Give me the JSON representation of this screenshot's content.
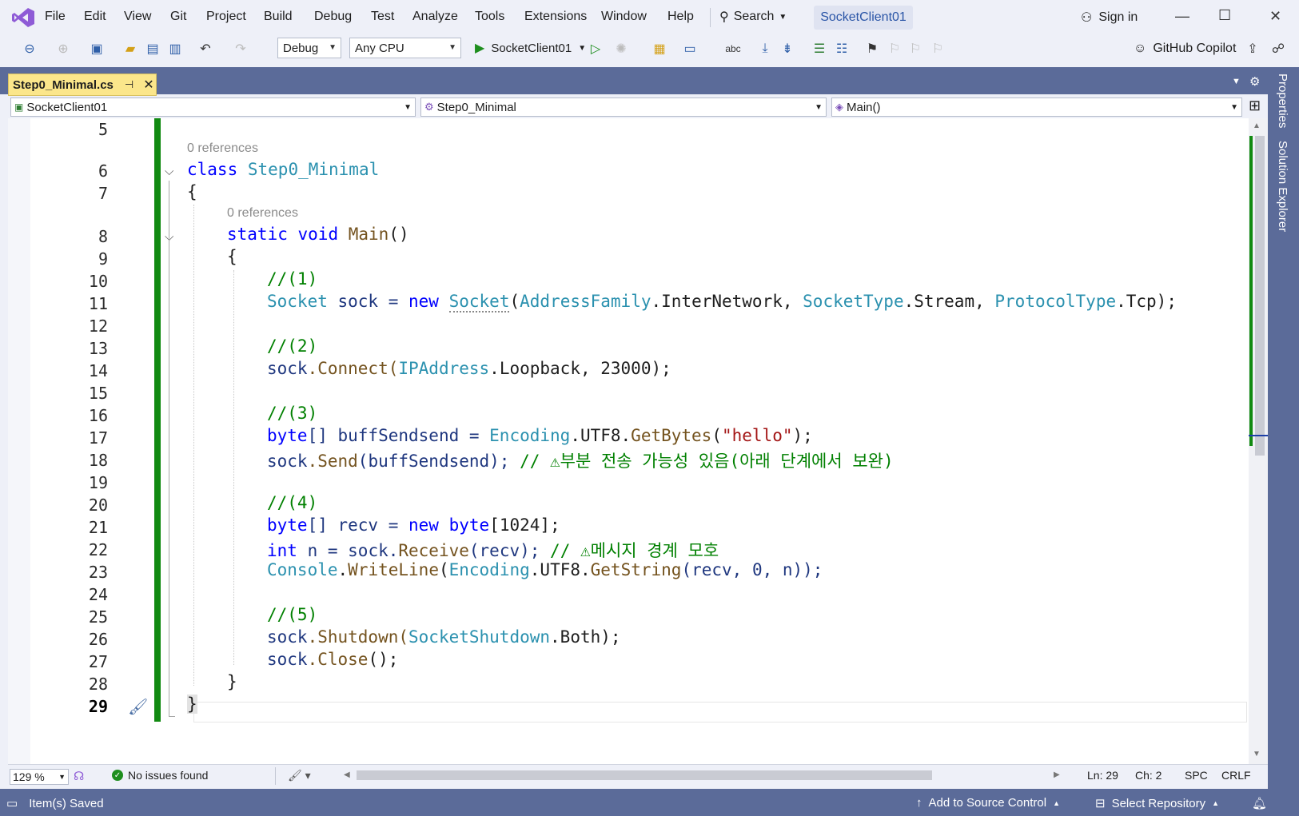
{
  "menubar": {
    "items": [
      "File",
      "Edit",
      "View",
      "Git",
      "Project",
      "Build",
      "Debug",
      "Test",
      "Analyze",
      "Tools",
      "Extensions",
      "Window",
      "Help"
    ],
    "search_label": "Search",
    "project_badge": "SocketClient01",
    "signin_label": "Sign in"
  },
  "toolbar": {
    "config_value": "Debug",
    "platform_value": "Any CPU",
    "run_target": "SocketClient01",
    "copilot_label": "GitHub Copilot"
  },
  "tab": {
    "filename": "Step0_Minimal.cs",
    "pin_glyph": "⊣",
    "close_glyph": "✕"
  },
  "navbar": {
    "project": "SocketClient01",
    "type": "Step0_Minimal",
    "member": "Main()"
  },
  "side_tabs": [
    "Properties",
    "Solution Explorer"
  ],
  "editor": {
    "line_numbers": [
      "5",
      "6",
      "7",
      "8",
      "9",
      "10",
      "11",
      "12",
      "13",
      "14",
      "15",
      "16",
      "17",
      "18",
      "19",
      "20",
      "21",
      "22",
      "23",
      "24",
      "25",
      "26",
      "27",
      "28",
      "29"
    ],
    "current_line": "29",
    "codelens_class": "0 references",
    "codelens_method": "0 references",
    "lines": {
      "l6_kw": "class",
      "l6_name": "Step0_Minimal",
      "l7": "{",
      "l8_kw1": "static",
      "l8_kw2": "void",
      "l8_name": "Main",
      "l8_rest": "()",
      "l9": "{",
      "l10": "//(1)",
      "l11_t1": "Socket",
      "l11_a": " sock = ",
      "l11_new": "new",
      "l11_t2": "Socket",
      "l11_p": "(",
      "l11_t3": "AddressFamily",
      "l11_b": ".InterNetwork, ",
      "l11_t4": "SocketType",
      "l11_c": ".Stream, ",
      "l11_t5": "ProtocolType",
      "l11_d": ".Tcp);",
      "l13": "//(2)",
      "l14_v": "sock",
      "l14_m": ".Connect(",
      "l14_t": "IPAddress",
      "l14_r": ".Loopback, 23000);",
      "l16": "//(3)",
      "l17_kw": "byte",
      "l17_a": "[] buffSendsend = ",
      "l17_t": "Encoding",
      "l17_b": ".UTF8.",
      "l17_m": "GetBytes",
      "l17_c": "(",
      "l17_s": "\"hello\"",
      "l17_d": ");",
      "l18_v": "sock",
      "l18_m": ".Send",
      "l18_a": "(buffSendsend); ",
      "l18_c": "// ⚠부분 전송 가능성 있음(아래 단계에서 보완)",
      "l20": "//(4)",
      "l21_kw": "byte",
      "l21_a": "[] recv = ",
      "l21_new": "new",
      "l21_sp": " ",
      "l21_kw2": "byte",
      "l21_b": "[1024];",
      "l22_kw": "int",
      "l22_a": " n = sock.",
      "l22_m": "Receive",
      "l22_b": "(recv); ",
      "l22_c": "// ⚠메시지 경계 모호",
      "l23_t": "Console",
      "l23_a": ".",
      "l23_m": "WriteLine",
      "l23_b": "(",
      "l23_t2": "Encoding",
      "l23_c": ".UTF8.",
      "l23_m2": "GetString",
      "l23_d": "(recv, 0, n));",
      "l25": "//(5)",
      "l26_v": "sock",
      "l26_m": ".Shutdown(",
      "l26_t": "SocketShutdown",
      "l26_r": ".Both);",
      "l27_v": "sock",
      "l27_m": ".Close",
      "l27_r": "();",
      "l28": "}",
      "l29": "}"
    }
  },
  "edit_status": {
    "zoom": "129 %",
    "issues": "No issues found",
    "ln": "Ln: 29",
    "ch": "Ch: 2",
    "spc": "SPC",
    "crlf": "CRLF"
  },
  "statusbar": {
    "saved": "Item(s) Saved",
    "source_control": "Add to Source Control",
    "repository": "Select Repository"
  },
  "colors": {
    "tab_active": "#fbe68b",
    "chrome_dark": "#5b6b99",
    "change_bar": "#118a11",
    "keyword": "#0000ff",
    "type": "#2b91af",
    "comment": "#008000",
    "string": "#a31515"
  }
}
